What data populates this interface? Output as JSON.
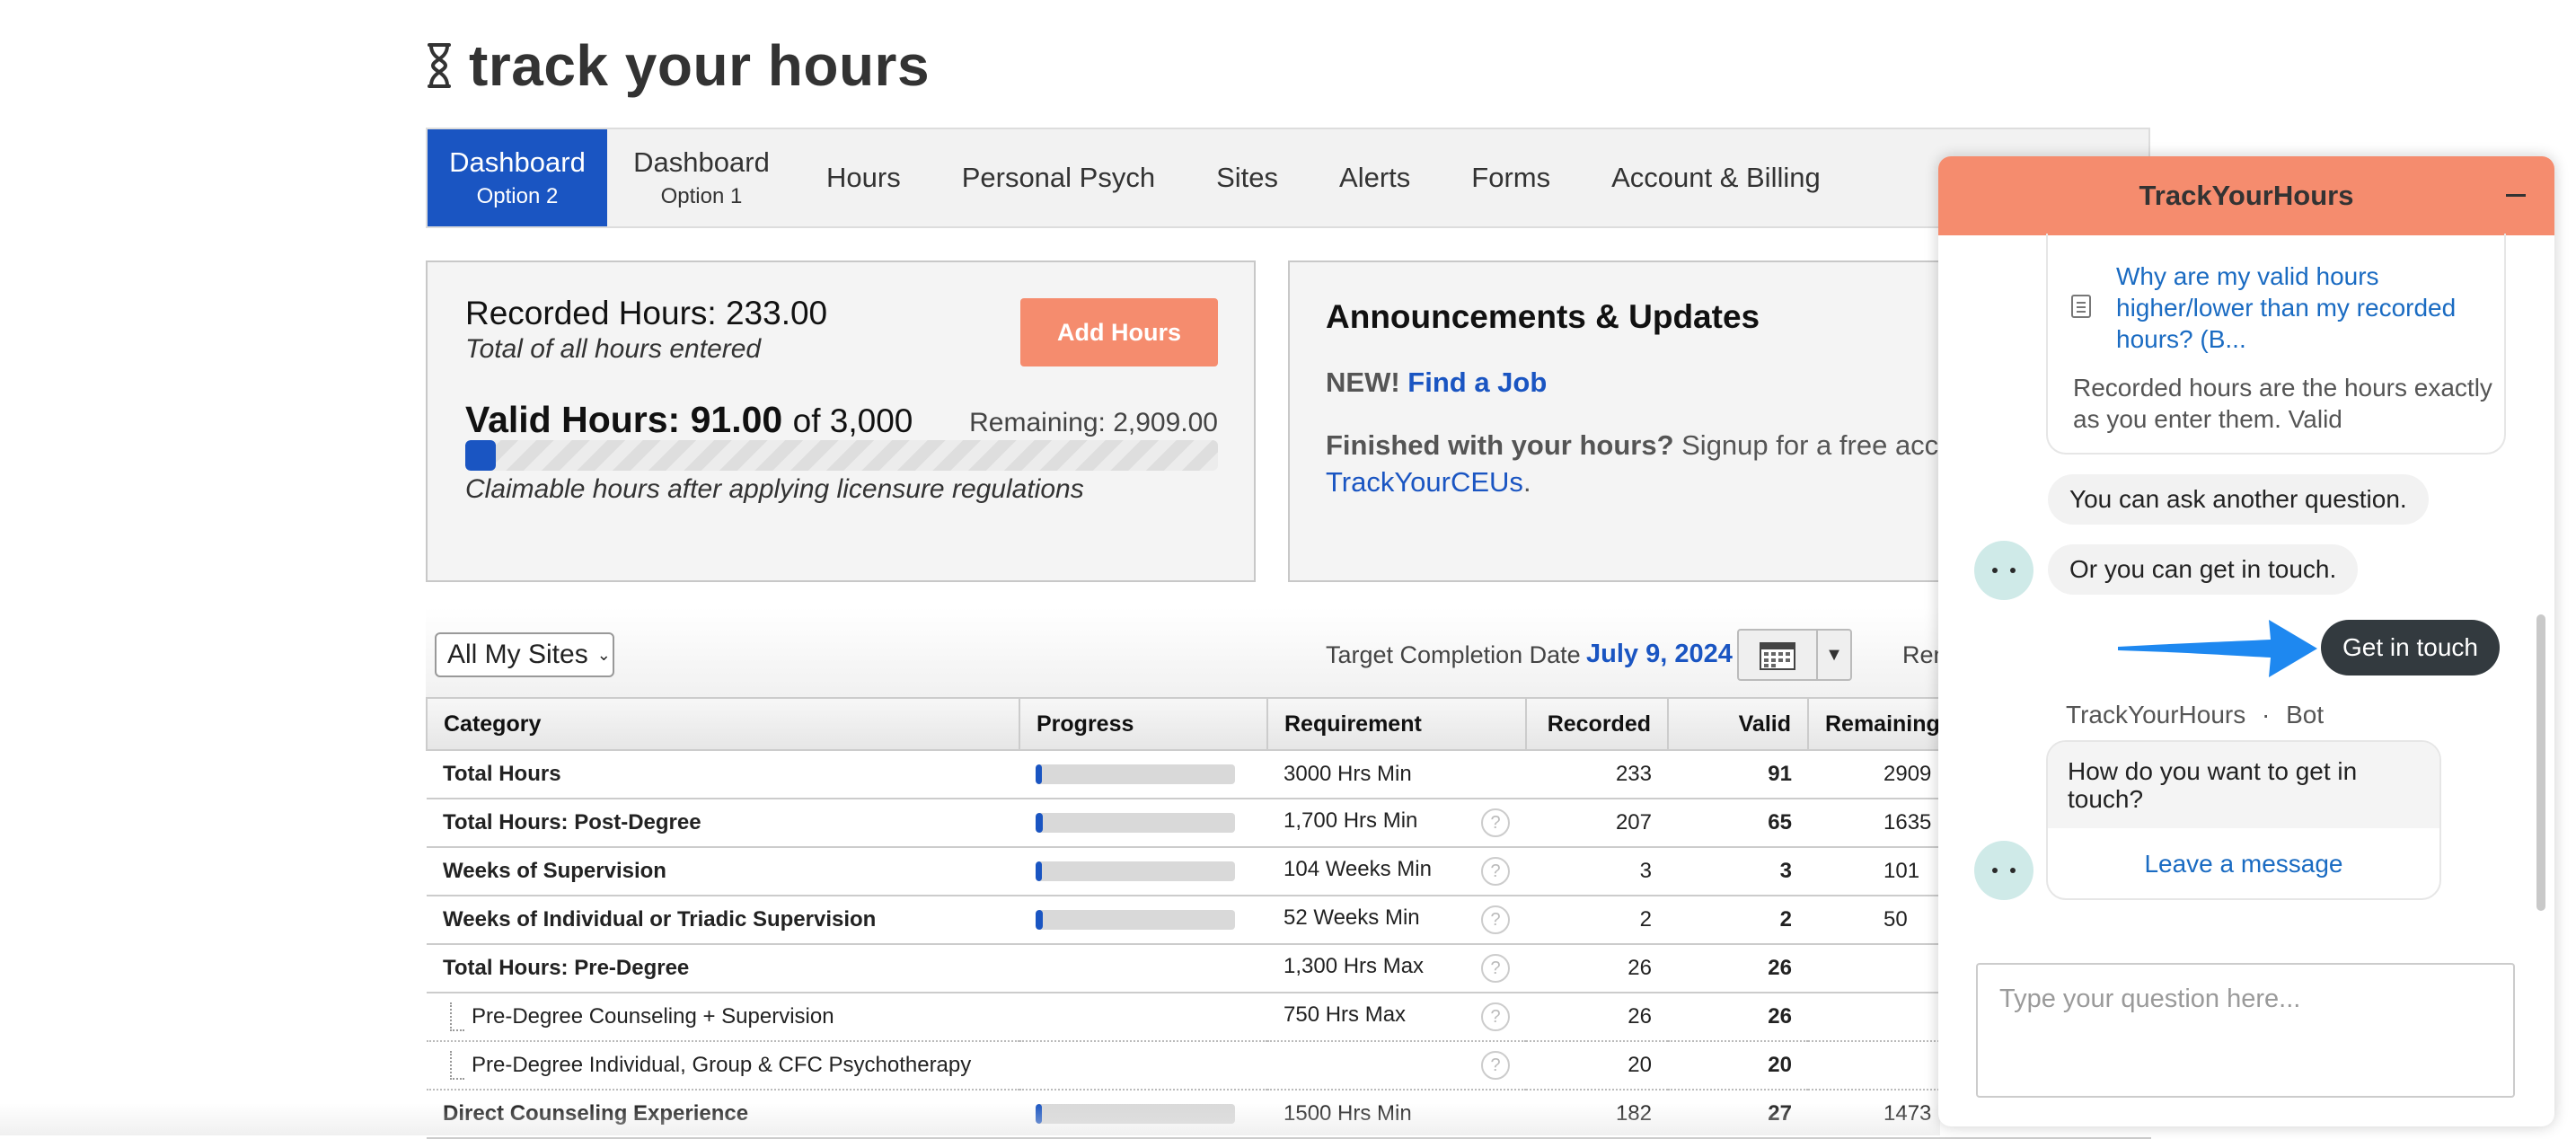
{
  "logo": {
    "text": "track your hours",
    "icon": "hourglass-icon"
  },
  "nav": {
    "items": [
      {
        "label": "Dashboard",
        "sub": "Option 2",
        "active": true
      },
      {
        "label": "Dashboard",
        "sub": "Option 1"
      },
      {
        "label": "Hours"
      },
      {
        "label": "Personal Psych"
      },
      {
        "label": "Sites"
      },
      {
        "label": "Alerts"
      },
      {
        "label": "Forms"
      },
      {
        "label": "Account & Billing"
      }
    ]
  },
  "hours_panel": {
    "recorded": "Recorded Hours: 233.00",
    "recorded_sub": "Total of all hours entered",
    "add_button": "Add Hours",
    "valid_label": "Valid Hours: 91.00",
    "valid_of": "of 3,000",
    "remaining": "Remaining: 2,909.00",
    "progress_fraction": 0.0303,
    "valid_sub": "Claimable hours after applying licensure regulations"
  },
  "announcements": {
    "title": "Announcements & Updates",
    "new_prefix": "NEW!",
    "new_link": "Find a Job",
    "finished_bold": "Finished with your hours?",
    "finished_text": "Signup for a free accou",
    "finished_link": "TrackYourCEUs",
    "finished_end": "."
  },
  "filter": {
    "site_select": "All My Sites",
    "target_label": "Target Completion Date",
    "target_date": "July 9, 2024",
    "remaining_label": "Rem"
  },
  "table": {
    "headers": [
      "Category",
      "Progress",
      "Requirement",
      "Recorded",
      "Valid",
      "Remaining"
    ],
    "rows": [
      {
        "category": "Total Hours",
        "progress": 0.0303,
        "requirement": "3000 Hrs Min",
        "help": false,
        "recorded": "233",
        "valid": "91",
        "remaining": "2909"
      },
      {
        "category": "Total Hours: Post-Degree",
        "progress": 0.038,
        "requirement": "1,700 Hrs Min",
        "help": true,
        "recorded": "207",
        "valid": "65",
        "remaining": "1635"
      },
      {
        "category": "Weeks of Supervision",
        "progress": 0.029,
        "requirement": "104 Weeks Min",
        "help": true,
        "recorded": "3",
        "valid": "3",
        "remaining": "101"
      },
      {
        "category": "Weeks of Individual or Triadic Supervision",
        "progress": 0.038,
        "requirement": "52 Weeks Min",
        "help": true,
        "recorded": "2",
        "valid": "2",
        "remaining": "50"
      },
      {
        "category": "Total Hours: Pre-Degree",
        "requirement": "1,300 Hrs Max",
        "help": true,
        "recorded": "26",
        "valid": "26",
        "remaining": ""
      },
      {
        "category": "Pre-Degree Counseling + Supervision",
        "sub": true,
        "requirement": "750 Hrs Max",
        "help": true,
        "recorded": "26",
        "valid": "26",
        "remaining": ""
      },
      {
        "category": "Pre-Degree Individual, Group & CFC Psychotherapy",
        "sub": true,
        "requirement": "",
        "help": true,
        "recorded": "20",
        "valid": "20",
        "remaining": ""
      },
      {
        "category": "Direct Counseling Experience",
        "progress": 0.018,
        "requirement": "1500 Hrs Min",
        "help": false,
        "recorded": "182",
        "valid": "27",
        "remaining": "1473"
      }
    ]
  },
  "chat": {
    "title": "TrackYourHours",
    "article_link": "Why are my valid hours higher/lower than my recorded hours? (B...",
    "article_snippet": "Recorded hours are the hours exactly as you enter them. Valid",
    "msg_ask": "You can ask another question.",
    "msg_touch": "Or you can get in touch.",
    "get_in_touch": "Get in touch",
    "bot_name": "TrackYourHours",
    "bot_sep": "·",
    "bot_role": "Bot",
    "bot_question": "How do you want to get in touch?",
    "leave_message": "Leave a message",
    "input_placeholder": "Type your question here...",
    "arrow_color": "#1e88f0"
  }
}
